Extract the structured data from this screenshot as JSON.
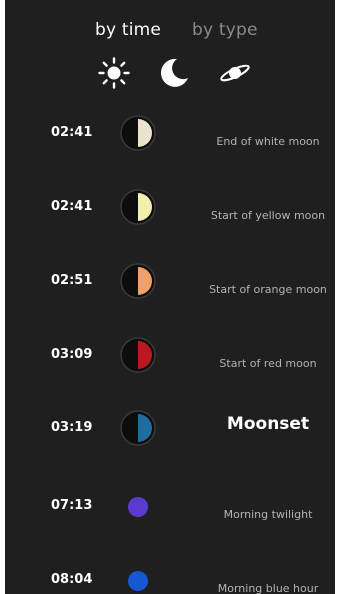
{
  "tabs": {
    "by_time": "by time",
    "by_type": "by type"
  },
  "filters": [
    {
      "icon": "sun-icon",
      "active": true
    },
    {
      "icon": "moon-icon",
      "active": true
    },
    {
      "icon": "planet-icon",
      "active": true
    }
  ],
  "colors": {
    "background": "#1f1f1f",
    "white_moon": "#ece3cc",
    "yellow_moon": "#f3efae",
    "orange_moon": "#f2a06a",
    "red_moon": "#b81a22",
    "blue_moon": "#1d6fa3",
    "twilight": "#5b3bcf",
    "blue_hour": "#1558d2"
  },
  "events": [
    {
      "time": "02:41",
      "label": "End of white moon",
      "icon": "white-moon-icon"
    },
    {
      "time": "02:41",
      "label": "Start of yellow moon",
      "icon": "yellow-moon-icon"
    },
    {
      "time": "02:51",
      "label": "Start of orange moon",
      "icon": "orange-moon-icon"
    },
    {
      "time": "03:09",
      "label": "Start of red moon",
      "icon": "red-moon-icon"
    },
    {
      "time": "03:19",
      "label": "Moonset",
      "icon": "moonset-icon"
    },
    {
      "time": "07:13",
      "label": "Morning twilight",
      "icon": "twilight-dot-icon"
    },
    {
      "time": "08:04",
      "label": "Morning blue hour",
      "icon": "blue-hour-dot-icon"
    }
  ]
}
